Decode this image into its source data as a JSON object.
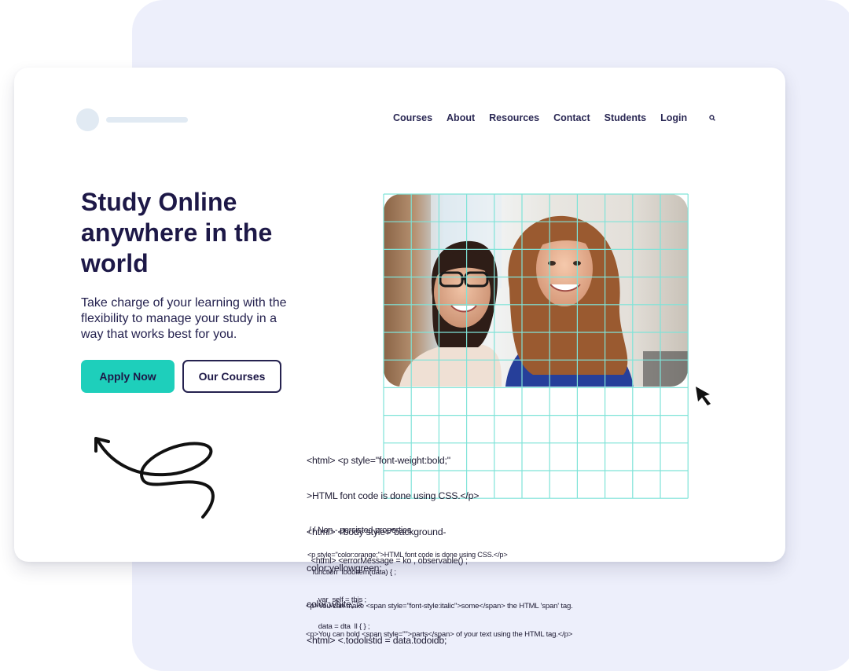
{
  "colors": {
    "background_panel": "#edeffb",
    "card": "#ffffff",
    "accent": "#1ecfbb",
    "heading": "#1d1847",
    "nav_text": "#2a2854",
    "logo_placeholder": "#e1eaf3",
    "grid_line": "#7fe3d8"
  },
  "header": {
    "logo": {
      "icon": "logo-placeholder-circle",
      "text_placeholder": "logo-placeholder-bar"
    },
    "nav": [
      {
        "label": "Courses"
      },
      {
        "label": "About"
      },
      {
        "label": "Resources"
      },
      {
        "label": "Contact"
      },
      {
        "label": "Students"
      },
      {
        "label": "Login"
      }
    ],
    "search_icon": "search-icon"
  },
  "hero": {
    "title_lines": [
      "Study Online",
      "anywhere in the",
      "world"
    ],
    "subtitle_lines": [
      "Take charge of your learning with the",
      "flexibility to manage your study in a",
      "way that works best for you."
    ],
    "primary_button": "Apply Now",
    "secondary_button": "Our Courses",
    "image_alt": "Two smiling students",
    "decoration": "curly-arrow-doodle"
  },
  "overlay": {
    "cursor_icon": "mouse-pointer-icon",
    "grid": "alignment-grid",
    "code_block_a": [
      "<html> <p style=\"font-weight:bold;\"",
      ">HTML font code is done using CSS.</p>",
      "<html> <body style=\"background-",
      "color:yellowgreen;",
      "color:white;\">",
      "<html> <.todolistid = data.todoidb;"
    ],
    "code_block_b": [
      " / / Non - persisted properties",
      "  <html> <errorMessage = ko , observable() ;"
    ],
    "code_block_c": [
      "<p style=\"color:orange;\">HTML font code is done using CSS.</p>"
    ],
    "code_block_d": [
      "   function  todoitem(data) { ;",
      "      var  self = this ;",
      "      data = dta  ll { } ;"
    ],
    "code_block_e": [
      "<p>You can make <span style=\"font-style:italic\">some</span> the HTML 'span' tag.",
      "<p>You can bold <span style=\"\">parts</span> of your text using the HTML tag.</p>"
    ]
  }
}
